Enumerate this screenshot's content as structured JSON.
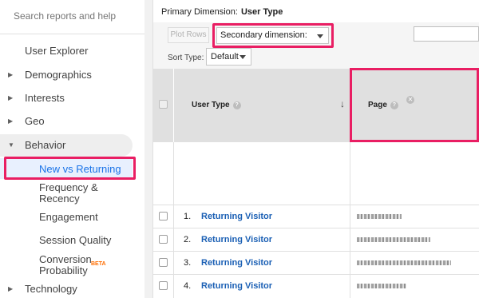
{
  "sidebar": {
    "search_placeholder": "Search reports and help",
    "items": [
      {
        "label": "User Explorer"
      },
      {
        "label": "Demographics"
      },
      {
        "label": "Interests"
      },
      {
        "label": "Geo"
      },
      {
        "label": "Behavior"
      },
      {
        "label": "New vs Returning"
      },
      {
        "label": "Frequency &"
      },
      {
        "label": "Recency"
      },
      {
        "label": "Engagement"
      },
      {
        "label": "Session Quality"
      },
      {
        "label": "Conversion"
      },
      {
        "label": "Probability"
      },
      {
        "label": "Technology"
      }
    ],
    "beta_badge": "BETA"
  },
  "report": {
    "primary_dimension_label": "Primary Dimension:",
    "primary_dimension_value": "User Type",
    "plot_rows": "Plot Rows",
    "secondary_dimension": "Secondary dimension: Page",
    "sort_type_label": "Sort Type:",
    "sort_type_value": "Default",
    "columns": {
      "user_type": "User Type",
      "page": "Page",
      "help_glyph": "?"
    },
    "rows": [
      {
        "num": "1.",
        "user_type": "Returning Visitor"
      },
      {
        "num": "2.",
        "user_type": "Returning Visitor"
      },
      {
        "num": "3.",
        "user_type": "Returning Visitor"
      },
      {
        "num": "4.",
        "user_type": "Returning Visitor"
      }
    ]
  },
  "colors": {
    "highlight": "#e91e63",
    "link": "#1a5fb4",
    "selected_nav": "#1a73e8"
  }
}
